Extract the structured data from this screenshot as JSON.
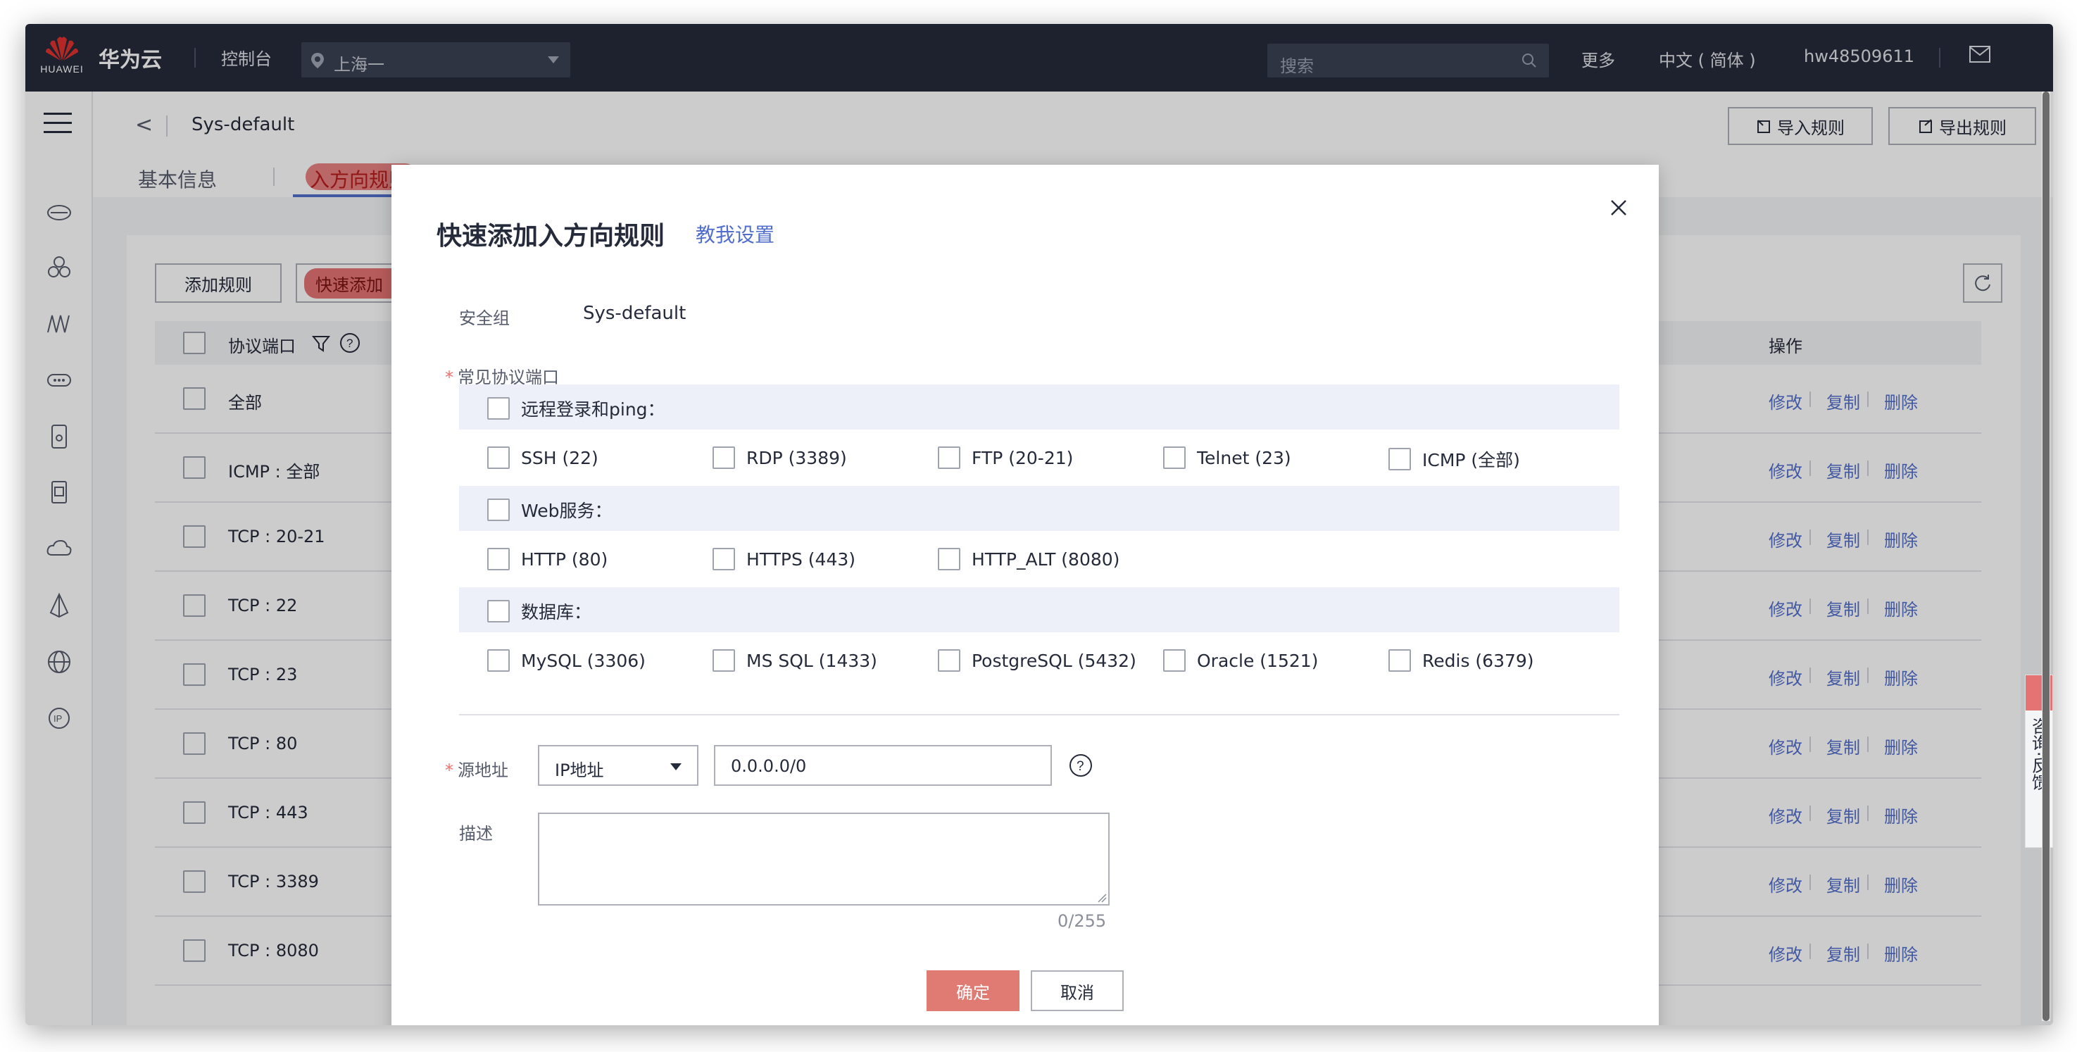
{
  "topbar": {
    "logo_text": "HUAWEI",
    "brand": "华为云",
    "console": "控制台",
    "region": "上海一",
    "search_placeholder": "搜索",
    "more": "更多",
    "language": "中文 ( 简体 )",
    "username": "hw48509611"
  },
  "page": {
    "back": "<",
    "sg_name": "Sys-default",
    "import_rules": "导入规则",
    "export_rules": "导出规则",
    "tabs": [
      "基本信息",
      "入方向规则"
    ]
  },
  "toolbar": {
    "add_rule": "添加规则",
    "quick_add": "快速添加"
  },
  "table": {
    "col_port": "协议端口",
    "col_ops": "操作",
    "rows": [
      {
        "port": "全部"
      },
      {
        "port": "ICMP : 全部"
      },
      {
        "port": "TCP : 20-21"
      },
      {
        "port": "TCP : 22"
      },
      {
        "port": "TCP : 23"
      },
      {
        "port": "TCP : 80"
      },
      {
        "port": "TCP : 443"
      },
      {
        "port": "TCP : 3389"
      },
      {
        "port": "TCP : 8080"
      }
    ],
    "op_modify": "修改",
    "op_copy": "复制",
    "op_delete": "删除"
  },
  "modal": {
    "title": "快速添加入方向规则",
    "help_link": "教我设置",
    "sg_label": "安全组",
    "sg_value": "Sys-default",
    "ports_label": "常见协议端口",
    "groups": [
      {
        "label": "远程登录和ping：",
        "options": [
          "SSH (22)",
          "RDP (3389)",
          "FTP (20-21)",
          "Telnet (23)",
          "ICMP (全部)"
        ]
      },
      {
        "label": "Web服务：",
        "options": [
          "HTTP (80)",
          "HTTPS (443)",
          "HTTP_ALT (8080)"
        ]
      },
      {
        "label": "数据库：",
        "options": [
          "MySQL (3306)",
          "MS SQL (1433)",
          "PostgreSQL (5432)",
          "Oracle (1521)",
          "Redis (6379)"
        ]
      }
    ],
    "source_label": "源地址",
    "source_type": "IP地址",
    "source_value": "0.0.0.0/0",
    "desc_label": "描述",
    "desc_counter": "0/255",
    "confirm": "确定",
    "cancel": "取消"
  },
  "feedback": {
    "text": "咨询·反馈"
  },
  "colors": {
    "topbar": "#252b3a",
    "accent": "#526ecc",
    "danger": "#e57373"
  }
}
